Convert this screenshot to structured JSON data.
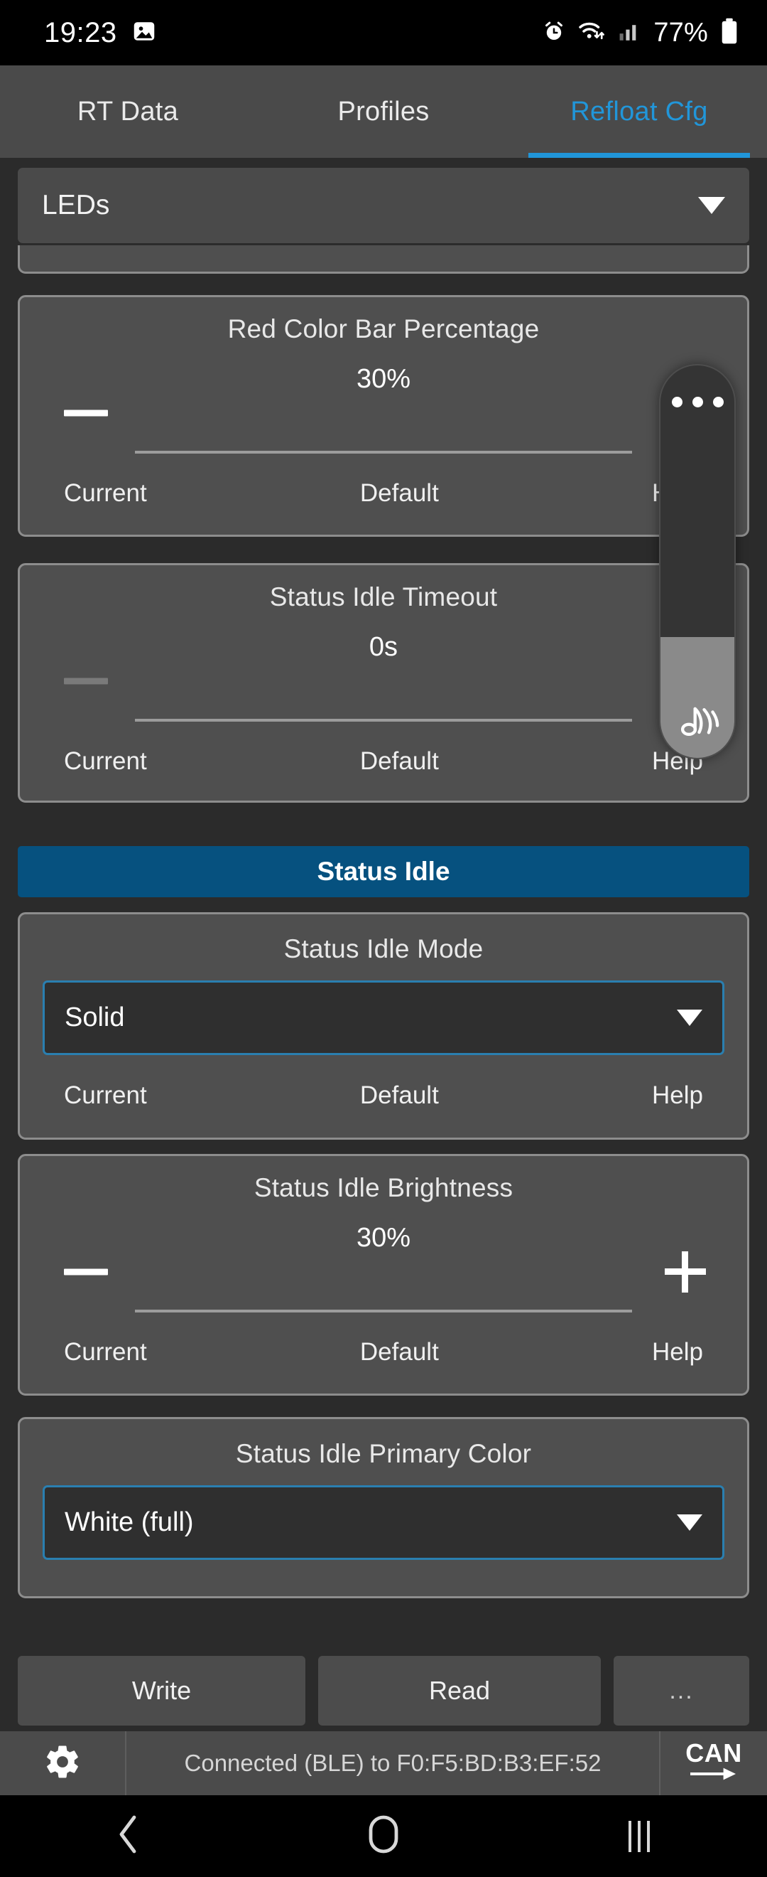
{
  "status_bar": {
    "time": "19:23",
    "left_icon": "image-icon",
    "icons": [
      "alarm-icon",
      "wifi-icon",
      "signal-icon"
    ],
    "battery_percent": "77%"
  },
  "tabs": [
    {
      "label": "RT Data",
      "active": false
    },
    {
      "label": "Profiles",
      "active": false
    },
    {
      "label": "Refloat Cfg",
      "active": true
    }
  ],
  "main_selector": {
    "value": "LEDs",
    "icon": "chevron-down-icon"
  },
  "cards": [
    {
      "title": "Red Color Bar Percentage",
      "value": "30%",
      "minus": "−",
      "plus": "",
      "minus_enabled": true,
      "plus_enabled": false,
      "current": "Current",
      "default": "Default",
      "help": "Help"
    },
    {
      "title": "Status Idle Timeout",
      "value": "0s",
      "minus": "−",
      "plus": "",
      "minus_enabled": false,
      "plus_enabled": false,
      "current": "Current",
      "default": "Default",
      "help": "Help"
    },
    {
      "title": "Status Idle Brightness",
      "value": "30%",
      "minus": "−",
      "plus": "+",
      "minus_enabled": true,
      "plus_enabled": true,
      "current": "Current",
      "default": "Default",
      "help": "Help"
    }
  ],
  "section_header": {
    "label": "Status Idle"
  },
  "mode_card": {
    "title": "Status Idle Mode",
    "selected": "Solid",
    "current": "Current",
    "default": "Default",
    "help": "Help"
  },
  "color_card": {
    "title": "Status Idle Primary Color",
    "selected": "White (full)"
  },
  "volume_overlay": {
    "menu_icon": "more-dots-icon",
    "media_icon": "music-note-icon"
  },
  "action_bar": {
    "write": "Write",
    "read": "Read",
    "more": "..."
  },
  "connection_bar": {
    "gear_icon": "gear-icon",
    "status": "Connected (BLE) to F0:F5:BD:B3:EF:52",
    "can_label": "CAN",
    "can_icon": "arrow-right-icon"
  },
  "nav_bar": {
    "back": "back-icon",
    "home": "home-icon",
    "recents": "recents-icon"
  },
  "colors": {
    "accent": "#2196d9",
    "section_blue": "#06517f",
    "card_bg": "#4f4f4f",
    "page_bg": "#2b2b2b"
  }
}
